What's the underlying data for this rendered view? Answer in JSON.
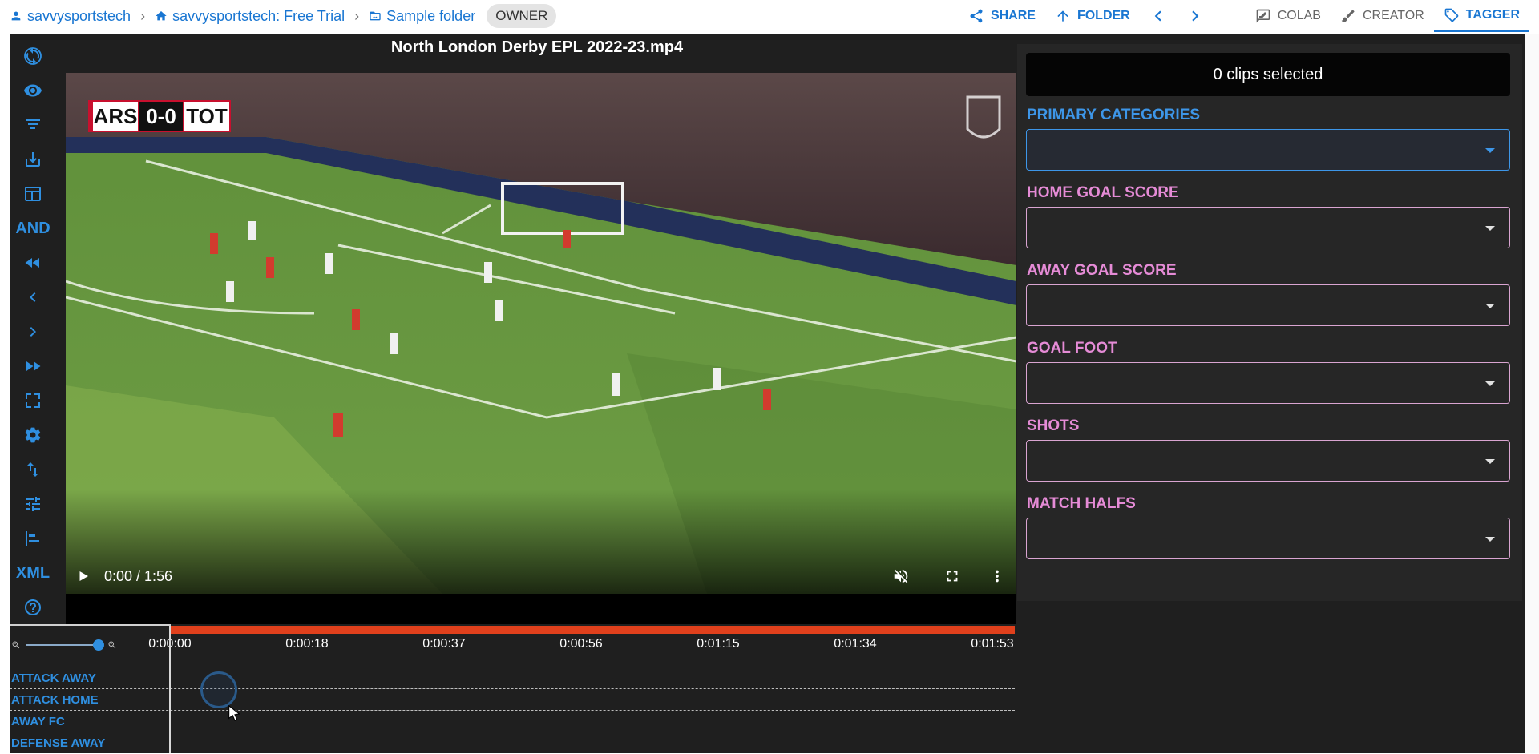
{
  "breadcrumb": {
    "user": "savvysportstech",
    "team": "savvysportstech: Free Trial",
    "folder": "Sample folder",
    "role": "OWNER",
    "separator": "›"
  },
  "top_actions": {
    "share": "SHARE",
    "folder": "FOLDER",
    "colab": "COLAB",
    "creator": "CREATOR",
    "tagger": "TAGGER"
  },
  "sidebar": {
    "and_label": "AND",
    "xml_label": "XML"
  },
  "video": {
    "title": "North London Derby EPL 2022-23.mp4",
    "time": "0:00 / 1:56",
    "scoreboard": {
      "home": "ARS",
      "score": "0-0",
      "away": "TOT"
    }
  },
  "tagger": {
    "clips_selected": "0 clips selected",
    "fields": [
      {
        "label": "PRIMARY CATEGORIES",
        "value": ""
      },
      {
        "label": "HOME GOAL SCORE",
        "value": ""
      },
      {
        "label": "AWAY GOAL SCORE",
        "value": ""
      },
      {
        "label": "GOAL FOOT",
        "value": ""
      },
      {
        "label": "SHOTS",
        "value": ""
      },
      {
        "label": "MATCH HALFS",
        "value": ""
      }
    ]
  },
  "timeline": {
    "ticks": [
      "0:00:00",
      "0:00:18",
      "0:00:37",
      "0:00:56",
      "0:01:15",
      "0:01:34",
      "0:01:53"
    ],
    "rows": [
      "ATTACK AWAY",
      "ATTACK HOME",
      "AWAY FC",
      "DEFENSE AWAY"
    ],
    "zoom_level": 1.0
  },
  "colors": {
    "accent": "#1976d2",
    "sidebar_icon": "#2f8fe0",
    "field_label": "#e58bd6",
    "primary_label": "#3d96e8",
    "timeline_bar": "#e0401c",
    "background": "#1f1f1f"
  }
}
